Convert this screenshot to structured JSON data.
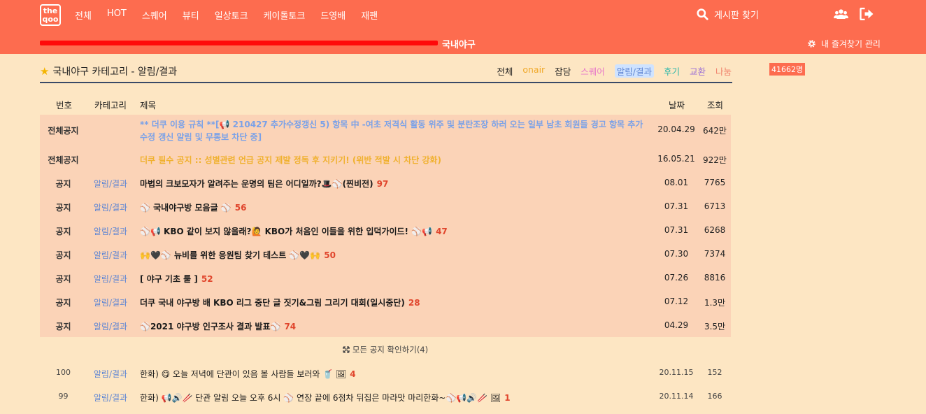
{
  "header": {
    "logo": [
      "the",
      "qoo"
    ],
    "nav": [
      "전체",
      "HOT",
      "스퀘어",
      "뷰티",
      "일상토크",
      "케이돌토크",
      "드영배",
      "재팬"
    ],
    "search_label": "게시판 찾기",
    "board_name": "국내야구",
    "fav_manage": "내 즐겨찾기 관리"
  },
  "category": {
    "title": "국내야구 카테고리 - 알림/결과",
    "tabs": [
      {
        "label": "전체",
        "color": "#222222"
      },
      {
        "label": "onair",
        "color": "#f0a92a"
      },
      {
        "label": "잡담",
        "color": "#222222"
      },
      {
        "label": "스퀘어",
        "color": "#e87ac9"
      },
      {
        "label": "알림/결과",
        "color": "#5f86d3"
      },
      {
        "label": "후기",
        "color": "#2ab7a9"
      },
      {
        "label": "교환",
        "color": "#9b6fd6"
      },
      {
        "label": "나눔",
        "color": "#f0806a"
      }
    ],
    "user_count": "41662명"
  },
  "table": {
    "headers": {
      "no": "번호",
      "cat": "카테고리",
      "title": "제목",
      "date": "날짜",
      "views": "조회"
    },
    "notices": [
      {
        "no": "전체공지",
        "cat": "",
        "title": "** 더쿠 이용 규칙 **[📢 210427 추가수정갱신 5) 항목 中 -여초 저격식 활동 위주 및 분란조장 하러 오는 일부 남초 회원들 경고 항목 추가 수정 갱신 알림 및 무통보 차단 중]",
        "comments": "",
        "date": "20.04.29",
        "views": "642만"
      },
      {
        "no": "전체공지",
        "cat": "",
        "title": "더쿠 필수 공지 :: 성별관련 언급 공지 제발 정독 후 지키기! (위반 적발 시 차단 강화)",
        "comments": "",
        "date": "16.05.21",
        "views": "922만"
      },
      {
        "no": "공지",
        "cat": "알림/결과",
        "title": "마법의 크보모자가 알려주는 운명의 팀은 어디일까?🎩⚾(찐비전)",
        "comments": "97",
        "date": "08.01",
        "views": "7765"
      },
      {
        "no": "공지",
        "cat": "알림/결과",
        "title": "⚾ 국내야구방 모음글 ⚾",
        "comments": "56",
        "date": "07.31",
        "views": "6713"
      },
      {
        "no": "공지",
        "cat": "알림/결과",
        "title": "⚾📢 KBO 같이 보지 않을래?🙋 KBO가 처음인 이들을 위한 입덕가이드! ⚾📢",
        "comments": "47",
        "date": "07.31",
        "views": "6268"
      },
      {
        "no": "공지",
        "cat": "알림/결과",
        "title": "🙌🖤⚾ 뉴비를 위한 응원팀 찾기 테스트 ⚾🖤🙌",
        "comments": "50",
        "date": "07.30",
        "views": "7374"
      },
      {
        "no": "공지",
        "cat": "알림/결과",
        "title": "[ 야구 기초 룰 ]",
        "comments": "52",
        "date": "07.26",
        "views": "8816"
      },
      {
        "no": "공지",
        "cat": "알림/결과",
        "title": "더쿠 국내 야구방 배 KBO 리그 중단 글 짓기&그림 그리기 대회(일시중단)",
        "comments": "28",
        "date": "07.12",
        "views": "1.3만"
      },
      {
        "no": "공지",
        "cat": "알림/결과",
        "title": "⚾2021 야구방 인구조사 결과 발표⚾",
        "comments": "74",
        "date": "04.29",
        "views": "3.5만"
      }
    ],
    "more_notice": "모든 공지 확인하기(4)",
    "posts": [
      {
        "no": "100",
        "cat": "알림/결과",
        "title": "한화) 😋 오늘 저녁에 단관이 있음 볼 사람들 보러와 🥤 🖼",
        "comments": "4",
        "date": "20.11.15",
        "views": "152"
      },
      {
        "no": "99",
        "cat": "알림/결과",
        "title": "한화) 📢🔊🥢 단관 알림 오늘 오후 6시 ⚾ 연장 끝에 6점차 뒤집은 마라맛 마리한화~⚾📢🔊🥢 🖼",
        "comments": "1",
        "date": "20.11.14",
        "views": "166"
      }
    ]
  },
  "colors": {
    "header_bg": "#fd6c4f",
    "page_bg": "#fde6c3",
    "notice_bg": "#fbd3b7",
    "category_blue": "#5f86d3"
  }
}
